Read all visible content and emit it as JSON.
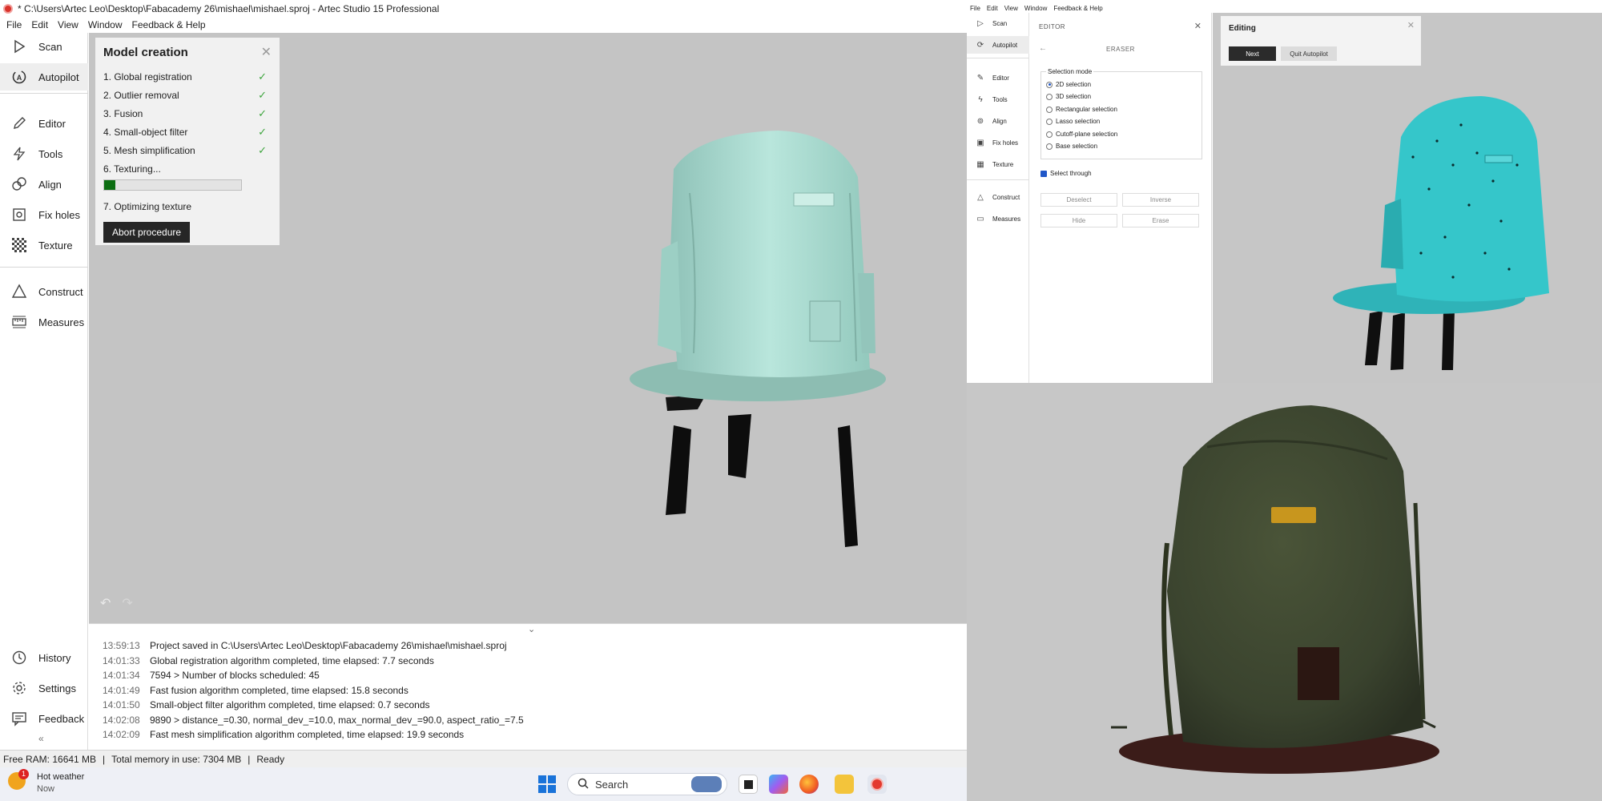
{
  "left_app": {
    "title": "* C:\\Users\\Artec Leo\\Desktop\\Fabacademy 26\\mishael\\mishael.sproj - Artec Studio 15 Professional",
    "menu": [
      "File",
      "Edit",
      "View",
      "Window",
      "Feedback & Help"
    ],
    "sidebar": {
      "items": [
        {
          "label": "Scan",
          "icon": "play-triangle-icon"
        },
        {
          "label": "Autopilot",
          "icon": "autopilot-icon",
          "active": true
        },
        {
          "label": "Editor",
          "icon": "pencil-icon"
        },
        {
          "label": "Tools",
          "icon": "lightning-icon"
        },
        {
          "label": "Align",
          "icon": "align-icon"
        },
        {
          "label": "Fix holes",
          "icon": "fix-holes-icon"
        },
        {
          "label": "Texture",
          "icon": "texture-checker-icon"
        },
        {
          "label": "Construct",
          "icon": "construct-triangle-icon"
        },
        {
          "label": "Measures",
          "icon": "ruler-icon"
        }
      ],
      "bottom_items": [
        {
          "label": "History",
          "icon": "history-icon"
        },
        {
          "label": "Settings",
          "icon": "gear-icon"
        },
        {
          "label": "Feedback",
          "icon": "feedback-icon"
        }
      ],
      "collapse_glyph": "«"
    },
    "model_panel": {
      "title": "Model creation",
      "steps": [
        {
          "label": "1. Global registration",
          "done": true
        },
        {
          "label": "2. Outlier removal",
          "done": true
        },
        {
          "label": "3. Fusion",
          "done": true
        },
        {
          "label": "4. Small-object filter",
          "done": true
        },
        {
          "label": "5. Mesh simplification",
          "done": true
        },
        {
          "label": "6. Texturing...",
          "done": false
        }
      ],
      "progress": 0.08,
      "next_step": "7. Optimizing texture",
      "abort_label": "Abort procedure"
    },
    "log": [
      {
        "time": "13:59:13",
        "text": "Project saved in C:\\Users\\Artec Leo\\Desktop\\Fabacademy 26\\mishael\\mishael.sproj"
      },
      {
        "time": "14:01:33",
        "text": "Global registration algorithm completed, time elapsed: 7.7 seconds"
      },
      {
        "time": "14:01:34",
        "text": "7594 > Number of blocks scheduled: 45"
      },
      {
        "time": "14:01:49",
        "text": "Fast fusion algorithm completed, time elapsed: 15.8 seconds"
      },
      {
        "time": "14:01:50",
        "text": "Small-object filter algorithm completed, time elapsed: 0.7 seconds"
      },
      {
        "time": "14:02:08",
        "text": "9890 > distance_=0.30, normal_dev_=10.0, max_normal_dev_=90.0, aspect_ratio_=7.5"
      },
      {
        "time": "14:02:09",
        "text": "Fast mesh simplification algorithm completed, time elapsed: 19.9 seconds"
      }
    ],
    "status": {
      "free_ram": "Free RAM: 16641 MB",
      "total_memory": "Total memory in use: 7304 MB",
      "state": "Ready"
    },
    "colors": {
      "viewport": "#c4c4c4",
      "mesh": "#a9d9cf",
      "progress": "#0c6e12",
      "check": "#3ea53e"
    }
  },
  "taskbar": {
    "weather_title": "Hot weather",
    "weather_sub": "Now",
    "weather_badge": "1",
    "search_placeholder": "Search"
  },
  "right_top_app": {
    "menu": [
      "File",
      "Edit",
      "View",
      "Window",
      "Feedback & Help"
    ],
    "sidebar": [
      {
        "label": "Scan",
        "icon": "play-triangle-icon"
      },
      {
        "label": "Autopilot",
        "icon": "autopilot-icon",
        "active": true
      },
      {
        "label": "Editor",
        "icon": "pencil-icon"
      },
      {
        "label": "Tools",
        "icon": "lightning-icon"
      },
      {
        "label": "Align",
        "icon": "align-icon"
      },
      {
        "label": "Fix holes",
        "icon": "fix-holes-icon"
      },
      {
        "label": "Texture",
        "icon": "texture-checker-icon"
      },
      {
        "label": "Construct",
        "icon": "construct-triangle-icon"
      },
      {
        "label": "Measures",
        "icon": "ruler-icon"
      }
    ],
    "editor": {
      "title": "EDITOR",
      "tool": "ERASER",
      "selection_mode_label": "Selection mode",
      "modes": [
        {
          "label": "2D selection",
          "selected": true
        },
        {
          "label": "3D selection",
          "selected": false
        },
        {
          "label": "Rectangular selection",
          "selected": false
        },
        {
          "label": "Lasso selection",
          "selected": false
        },
        {
          "label": "Cutoff-plane selection",
          "selected": false
        },
        {
          "label": "Base selection",
          "selected": false
        }
      ],
      "select_through": "Select through",
      "buttons": {
        "deselect": "Deselect",
        "inverse": "Inverse",
        "hide": "Hide",
        "erase": "Erase"
      }
    },
    "editing_panel": {
      "title": "Editing",
      "next": "Next",
      "quit": "Quit Autopilot"
    },
    "colors": {
      "mesh": "#2fc0c4"
    }
  },
  "right_bottom": {
    "colors": {
      "background": "#c7c7c7",
      "backpack": "#3b4430",
      "tag": "#c8961e",
      "patch": "#2b1712"
    }
  }
}
